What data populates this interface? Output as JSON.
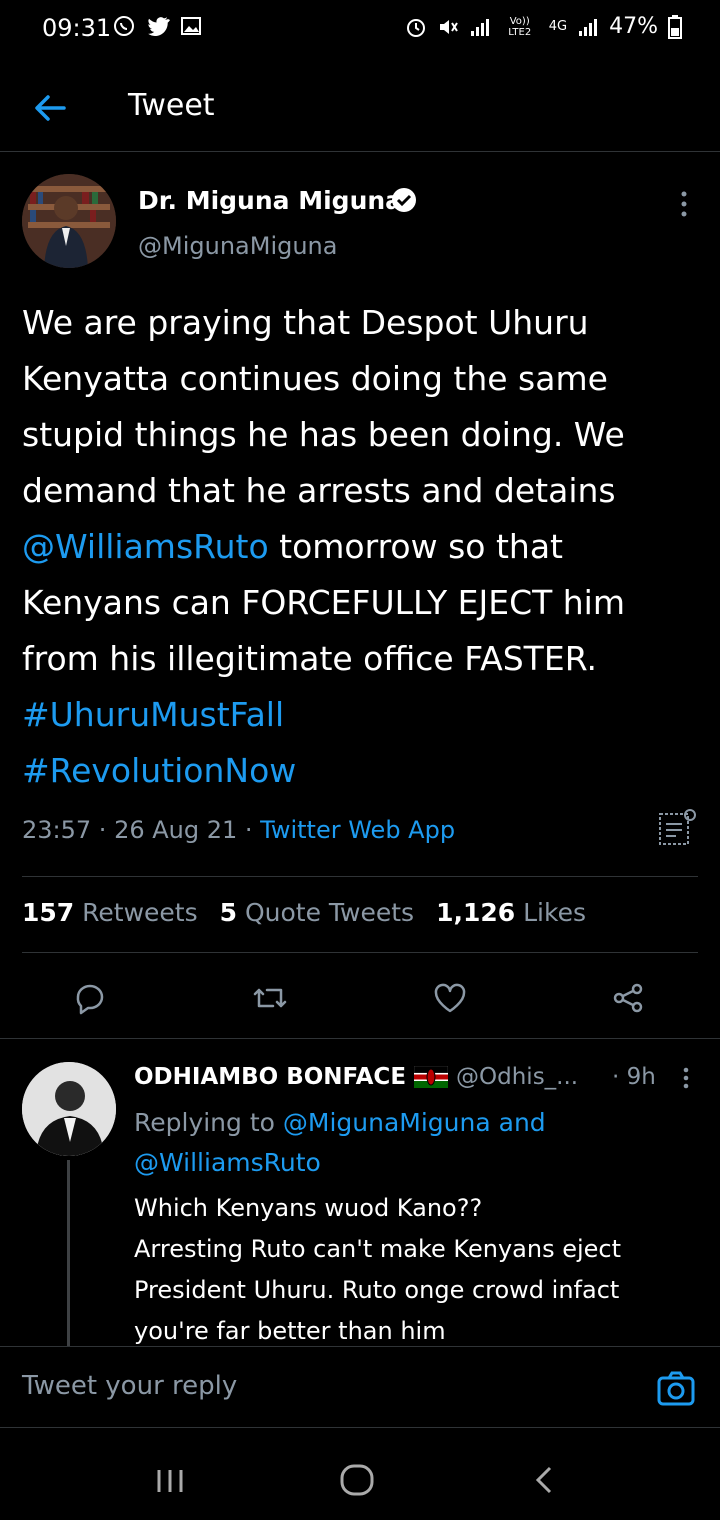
{
  "status_bar": {
    "time": "09:31",
    "battery": "47%",
    "network": "4G",
    "volte": "Vo)) LTE2"
  },
  "header": {
    "title": "Tweet"
  },
  "tweet": {
    "author_name": "Dr. Miguna Miguna",
    "author_handle": "@MigunaMiguna",
    "text_parts": {
      "p1": "We are praying that Despot Uhuru Kenyatta continues doing the same stupid things he has been doing. We demand that he arrests and detains ",
      "mention": "@WilliamsRuto",
      "p2": " tomorrow so that Kenyans can FORCEFULLY EJECT him from his illegitimate office FASTER. ",
      "hashtag1": "#UhuruMustFall",
      "hashtag2": "#RevolutionNow"
    },
    "time": "23:57",
    "date": "26 Aug 21",
    "source": "Twitter Web App",
    "retweets_count": "157",
    "retweets_label": "Retweets",
    "quotes_count": "5",
    "quotes_label": "Quote Tweets",
    "likes_count": "1,126",
    "likes_label": "Likes"
  },
  "reply": {
    "author_name": "ODHIAMBO BONFACE",
    "author_handle": "@Odhis_...",
    "age": "9h",
    "replying_prefix": "Replying to ",
    "replying_to_1": "@MigunaMiguna",
    "replying_and": " and",
    "replying_to_2": "@WilliamsRuto",
    "body_line1": "Which Kenyans wuod Kano??",
    "body_line2": "Arresting Ruto can't make Kenyans eject President Uhuru. Ruto onge crowd infact you're far better than him"
  },
  "composer": {
    "placeholder": "Tweet your reply"
  },
  "colors": {
    "accent": "#1d9bf0",
    "background": "#000000",
    "secondary_text": "#8b98a5"
  }
}
